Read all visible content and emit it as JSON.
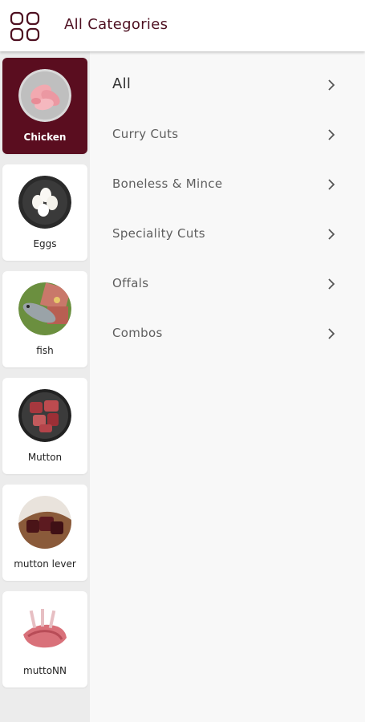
{
  "header": {
    "title": "All Categories",
    "menu_icon": "grid-icon"
  },
  "sidebar": {
    "items": [
      {
        "label": "Chicken",
        "icon": "chicken-image",
        "active": true
      },
      {
        "label": "Eggs",
        "icon": "eggs-image",
        "active": false
      },
      {
        "label": "fish",
        "icon": "fish-image",
        "active": false
      },
      {
        "label": "Mutton",
        "icon": "mutton-image",
        "active": false
      },
      {
        "label": "mutton lever",
        "icon": "mutton-liver-image",
        "active": false
      },
      {
        "label": "muttoNN",
        "icon": "mutton-ribs-image",
        "active": false
      }
    ]
  },
  "subcategories": [
    {
      "label": "All"
    },
    {
      "label": "Curry Cuts"
    },
    {
      "label": "Boneless & Mince"
    },
    {
      "label": "Speciality Cuts"
    },
    {
      "label": "Offals"
    },
    {
      "label": "Combos"
    }
  ],
  "colors": {
    "accent": "#5a0d1f",
    "title": "#4e1021",
    "background": "#f8f8f8",
    "sidebar_bg": "#ececec"
  }
}
